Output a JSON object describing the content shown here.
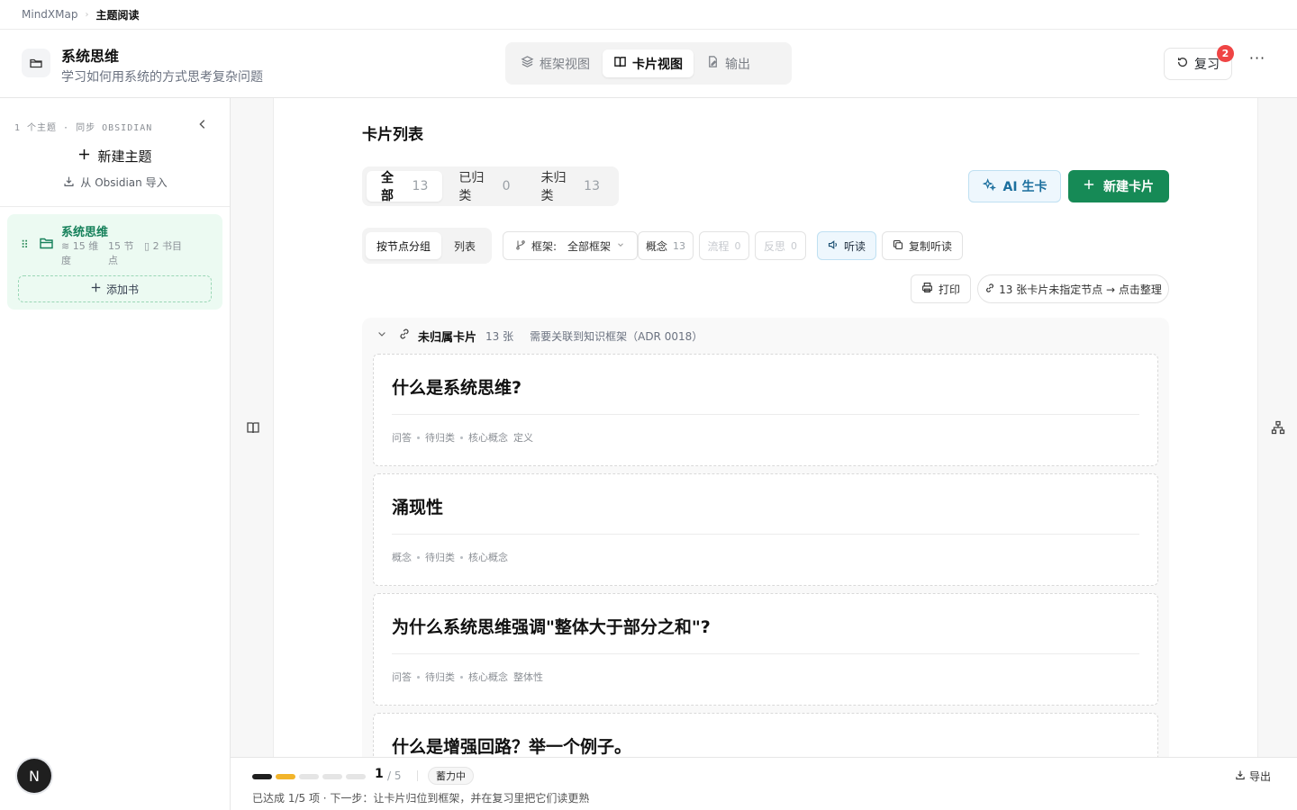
{
  "breadcrumb": {
    "root": "MindXMap",
    "current": "主题阅读"
  },
  "header": {
    "title": "系统思维",
    "subtitle": "学习如何用系统的方式思考复杂问题",
    "view_tabs": [
      "框架视图",
      "卡片视图",
      "输出"
    ],
    "active_view": "卡片视图",
    "review_label": "复习",
    "review_badge": "2",
    "more": "···"
  },
  "sidebar": {
    "meta": "1 个主题 · 同步 OBSIDIAN",
    "new_topic": "新建主题",
    "import": "从 Obsidian 导入",
    "topic": {
      "title": "系统思维",
      "dimensions": "15 维度",
      "nodes": "15 节点",
      "books": "2 书目",
      "add_book": "添加书"
    },
    "avatar": "N"
  },
  "main": {
    "title": "卡片列表",
    "filter_tabs": [
      {
        "label": "全部",
        "count": "13"
      },
      {
        "label": "已归类",
        "count": "0"
      },
      {
        "label": "未归类",
        "count": "13"
      }
    ],
    "ai_button": "AI 生卡",
    "new_card_button": "新建卡片",
    "group_tabs": [
      "按节点分组",
      "列表"
    ],
    "framework_label": "框架:",
    "framework_value": "全部框架",
    "type_chips": [
      {
        "label": "概念",
        "count": "13"
      },
      {
        "label": "流程",
        "count": "0"
      },
      {
        "label": "反思",
        "count": "0"
      }
    ],
    "listen": "听读",
    "copy_listen": "复制听读",
    "print": "打印",
    "organize": "13 张卡片未指定节点 → 点击整理",
    "group": {
      "name": "未归属卡片",
      "count": "13 张",
      "note": "需要关联到知识框架（ADR 0018）"
    },
    "cards": [
      {
        "title": "什么是系统思维?",
        "type": "问答",
        "status": "待归类",
        "tags": [
          "核心概念",
          "定义"
        ]
      },
      {
        "title": "涌现性",
        "type": "概念",
        "status": "待归类",
        "tags": [
          "核心概念"
        ]
      },
      {
        "title": "为什么系统思维强调\"整体大于部分之和\"?",
        "type": "问答",
        "status": "待归类",
        "tags": [
          "核心概念",
          "整体性"
        ]
      },
      {
        "title": "什么是增强回路？举一个例子。",
        "type": "",
        "status": "",
        "tags": []
      }
    ]
  },
  "progress": {
    "current": "1",
    "total": "/ 5",
    "badge": "蓄力中",
    "message": "已达成 1/5 项 · 下一步：让卡片归位到框架，并在复习里把它们读更熟",
    "export": "导出",
    "completed_fraction": 0.2
  },
  "colors": {
    "primary_green": "#168a56",
    "ai_blue": "#1b6f9e",
    "badge_red": "#ef4444",
    "progress_amber": "#f2b42a"
  }
}
